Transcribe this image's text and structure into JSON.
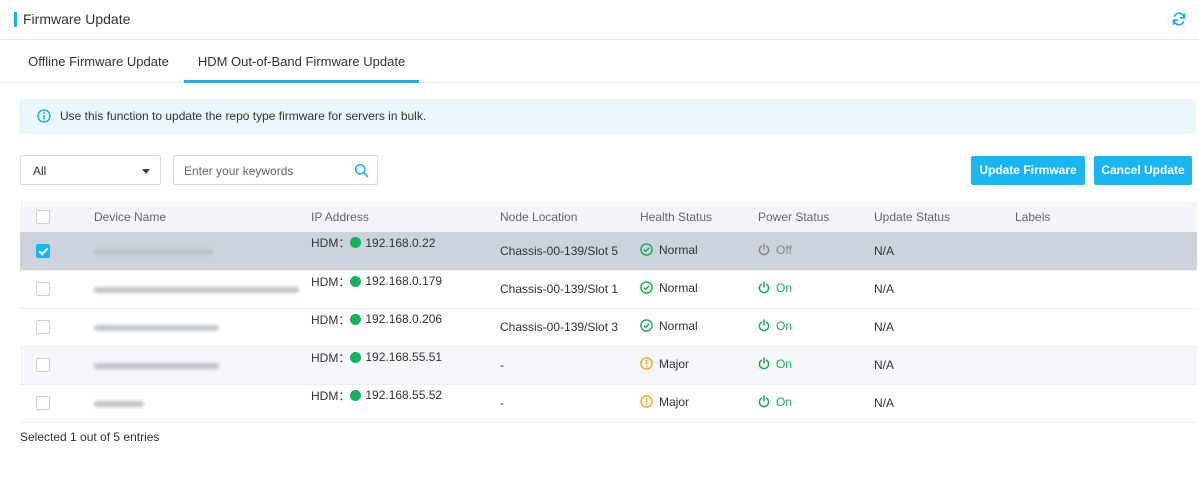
{
  "header": {
    "title": "Firmware Update"
  },
  "tabs": [
    {
      "label": "Offline Firmware Update"
    },
    {
      "label": "HDM Out-of-Band Firmware Update"
    }
  ],
  "notice": {
    "text": "Use this function to update the repo type firmware for servers in bulk."
  },
  "toolbar": {
    "filter_value": "All",
    "search_placeholder": "Enter your keywords",
    "update_label": "Update Firmware",
    "cancel_label": "Cancel Update"
  },
  "table": {
    "columns": [
      "Device Name",
      "IP Address",
      "Node Location",
      "Health Status",
      "Power Status",
      "Update Status",
      "Labels"
    ],
    "rows": [
      {
        "checked": true,
        "ip_prefix": "HDM：",
        "ip": "192.168.0.22",
        "node": "Chassis-00-139/Slot 5",
        "health": "Normal",
        "power": "Off",
        "update": "N/A"
      },
      {
        "checked": false,
        "ip_prefix": "HDM：",
        "ip": "192.168.0.179",
        "node": "Chassis-00-139/Slot 1",
        "health": "Normal",
        "power": "On",
        "update": "N/A"
      },
      {
        "checked": false,
        "ip_prefix": "HDM：",
        "ip": "192.168.0.206",
        "node": "Chassis-00-139/Slot 3",
        "health": "Normal",
        "power": "On",
        "update": "N/A"
      },
      {
        "checked": false,
        "ip_prefix": "HDM：",
        "ip": "192.168.55.51",
        "node": "-",
        "health": "Major",
        "power": "On",
        "update": "N/A"
      },
      {
        "checked": false,
        "ip_prefix": "HDM：",
        "ip": "192.168.55.52",
        "node": "-",
        "health": "Major",
        "power": "On",
        "update": "N/A"
      }
    ]
  },
  "footer": {
    "text": "Selected 1 out of 5 entries"
  },
  "colors": {
    "accent": "#16b1f0",
    "online": "#12b35b",
    "normal": "#1aa954",
    "major": "#f5a623"
  }
}
